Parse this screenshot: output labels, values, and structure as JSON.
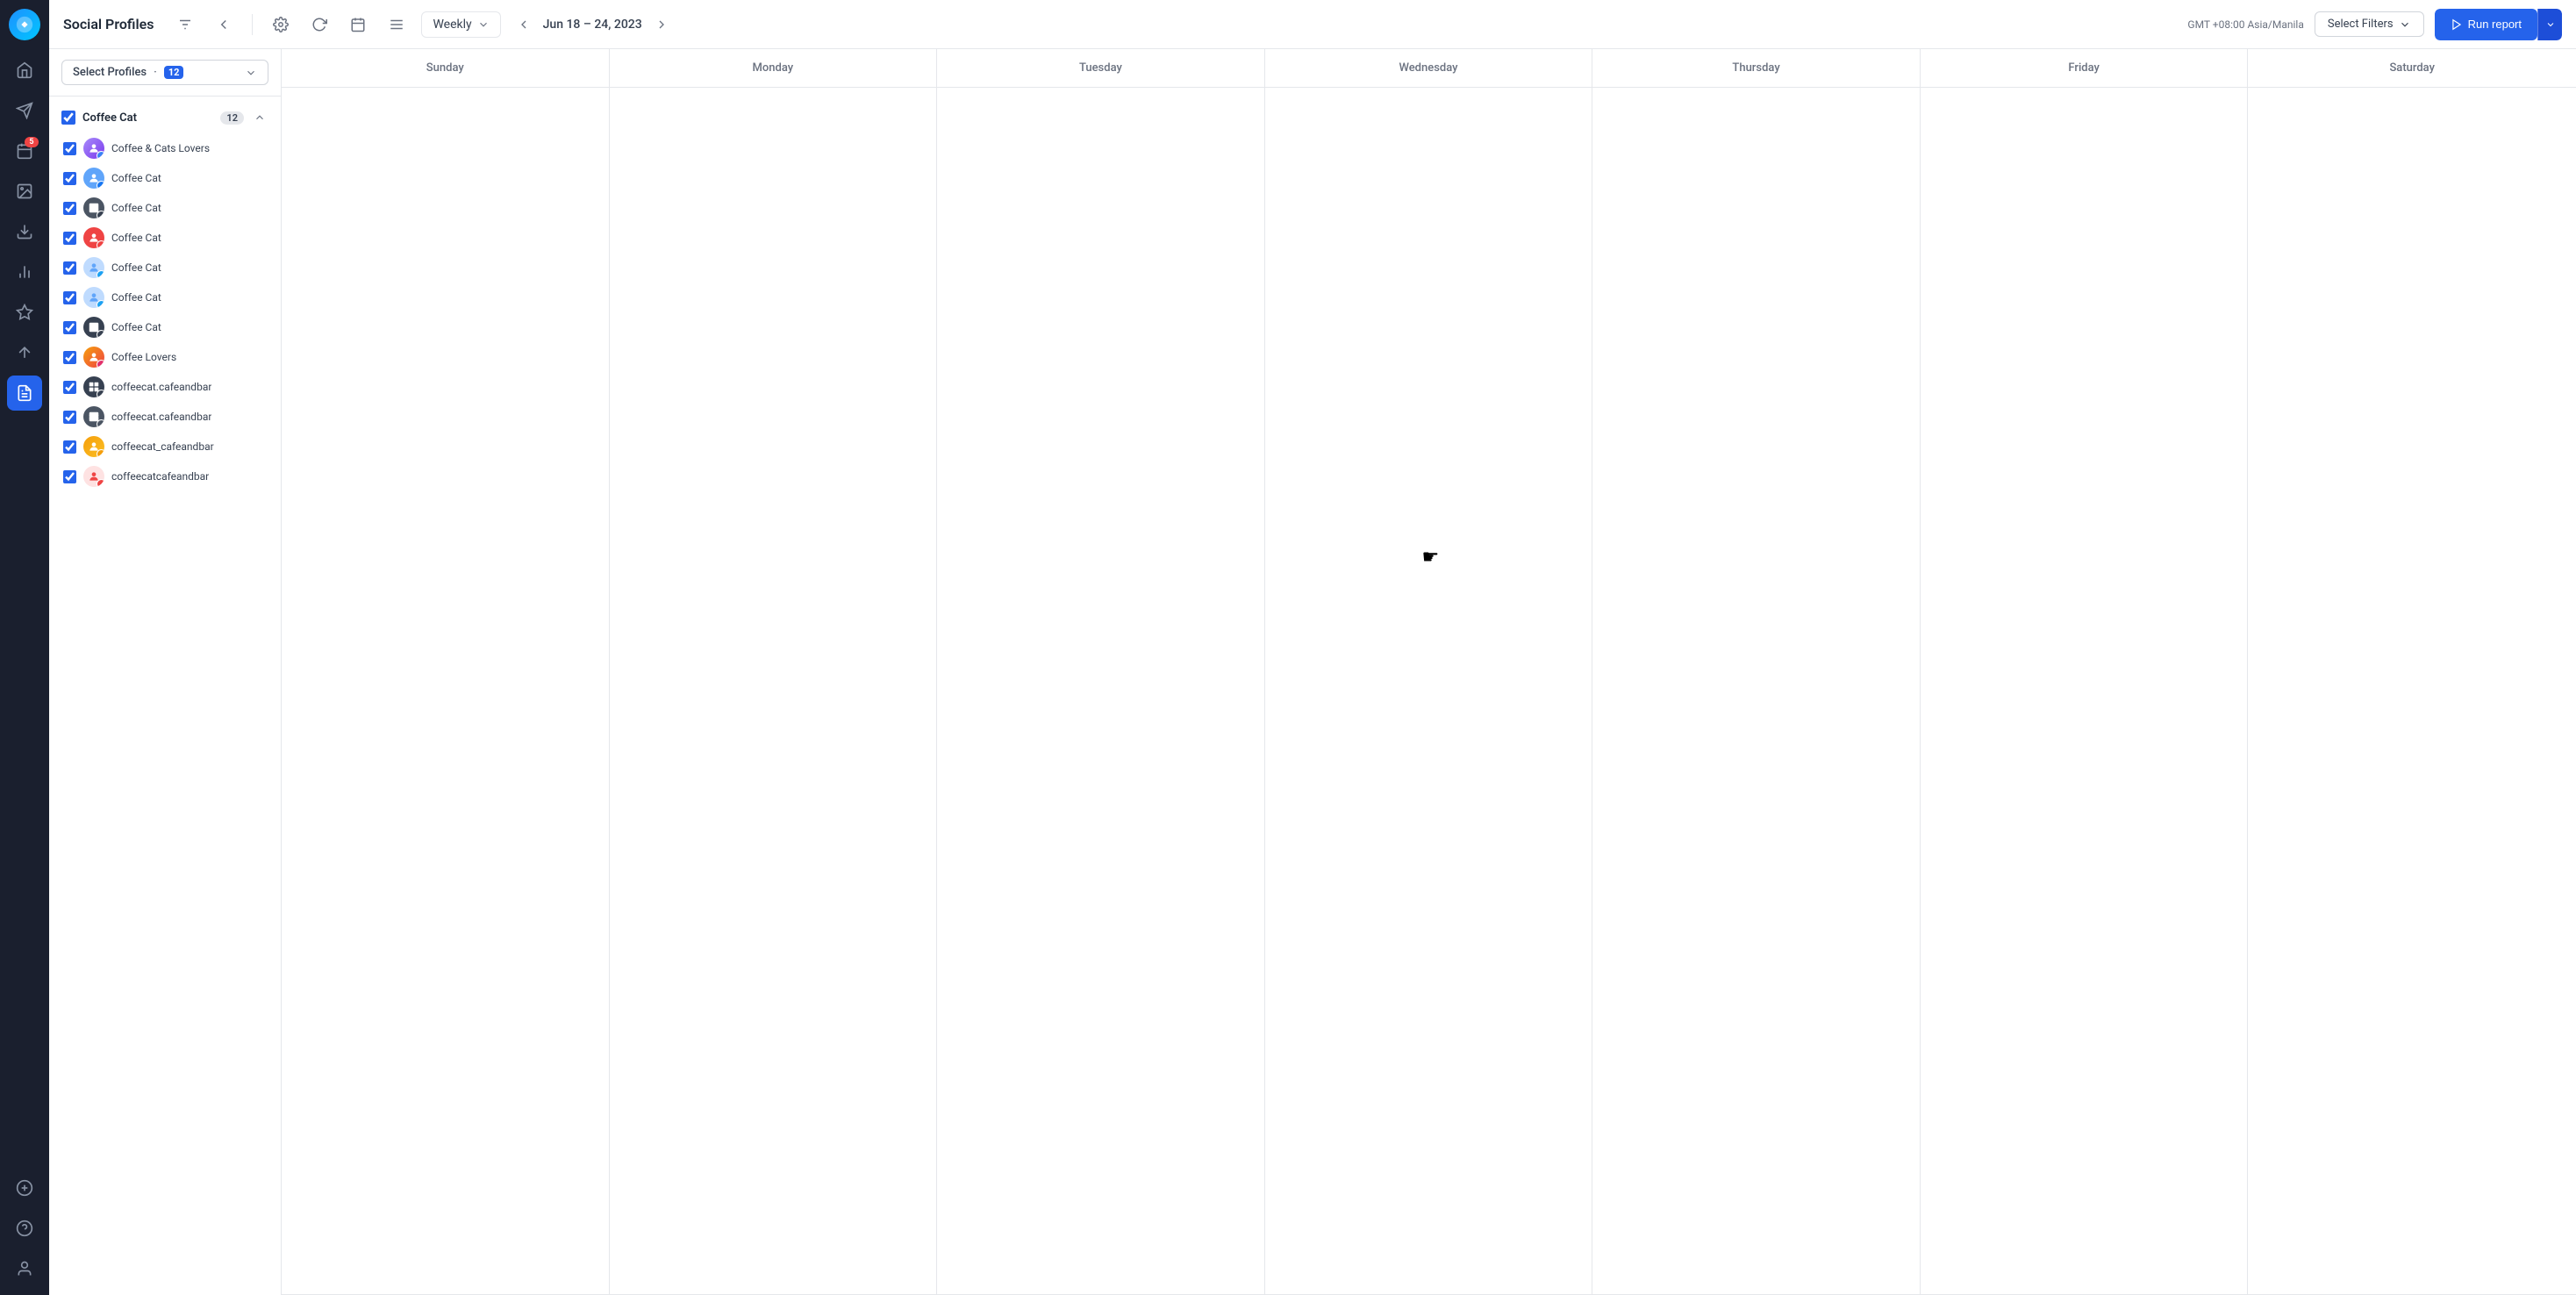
{
  "app": {
    "title": "Social Profiles"
  },
  "nav": {
    "items": [
      {
        "id": "home",
        "icon": "home",
        "active": false
      },
      {
        "id": "send",
        "icon": "send",
        "active": false
      },
      {
        "id": "calendar",
        "icon": "calendar",
        "active": false,
        "badge": "5"
      },
      {
        "id": "image",
        "icon": "image",
        "active": false
      },
      {
        "id": "download",
        "icon": "download",
        "active": false
      },
      {
        "id": "analytics",
        "icon": "analytics",
        "active": false
      },
      {
        "id": "star",
        "icon": "star",
        "active": false
      },
      {
        "id": "pen",
        "icon": "pen",
        "active": false
      },
      {
        "id": "reports",
        "icon": "reports",
        "active": true
      }
    ],
    "bottom": [
      {
        "id": "add",
        "icon": "add"
      },
      {
        "id": "help",
        "icon": "help"
      },
      {
        "id": "profile",
        "icon": "profile"
      }
    ]
  },
  "toolbar": {
    "settings_title": "Social Profiles",
    "weekly_label": "Weekly",
    "date_range": "Jun 18 – 24, 2023",
    "timezone": "GMT +08:00 Asia/Manila",
    "select_filters_label": "Select Filters",
    "run_report_label": "Run report"
  },
  "sidebar": {
    "select_profiles_label": "Select Profiles",
    "select_profiles_count": "12",
    "group": {
      "name": "Coffee Cat",
      "count": "12",
      "items": [
        {
          "id": 1,
          "name": "Coffee & Cats Lovers",
          "color": "#a78bfa",
          "platform": "multi"
        },
        {
          "id": 2,
          "name": "Coffee Cat",
          "color": "#60a5fa",
          "platform": "fb"
        },
        {
          "id": 3,
          "name": "Coffee Cat",
          "color": "#374151",
          "platform": "table"
        },
        {
          "id": 4,
          "name": "Coffee Cat",
          "color": "#ef4444",
          "platform": "youtube"
        },
        {
          "id": 5,
          "name": "Coffee Cat",
          "color": "#60a5fa",
          "platform": "twitter"
        },
        {
          "id": 6,
          "name": "Coffee Cat",
          "color": "#60a5fa",
          "platform": "twitter"
        },
        {
          "id": 7,
          "name": "Coffee Cat",
          "color": "#374151",
          "platform": "table2"
        },
        {
          "id": 8,
          "name": "Coffee Lovers",
          "color": "#a78bfa",
          "platform": "multi"
        },
        {
          "id": 9,
          "name": "coffeecat.cafeandbar",
          "color": "#374151",
          "platform": "ig"
        },
        {
          "id": 10,
          "name": "coffeecat.cafeandbar",
          "color": "#374151",
          "platform": "table3"
        },
        {
          "id": 11,
          "name": "coffeecat_cafeandbar",
          "color": "#f59e0b",
          "platform": "multi2"
        },
        {
          "id": 12,
          "name": "coffeecatcafeandbar",
          "color": "#ef4444",
          "platform": "tiktok"
        }
      ]
    }
  },
  "calendar": {
    "days": [
      "Sunday",
      "Monday",
      "Tuesday",
      "Wednesday",
      "Thursday",
      "Friday",
      "Saturday"
    ]
  }
}
